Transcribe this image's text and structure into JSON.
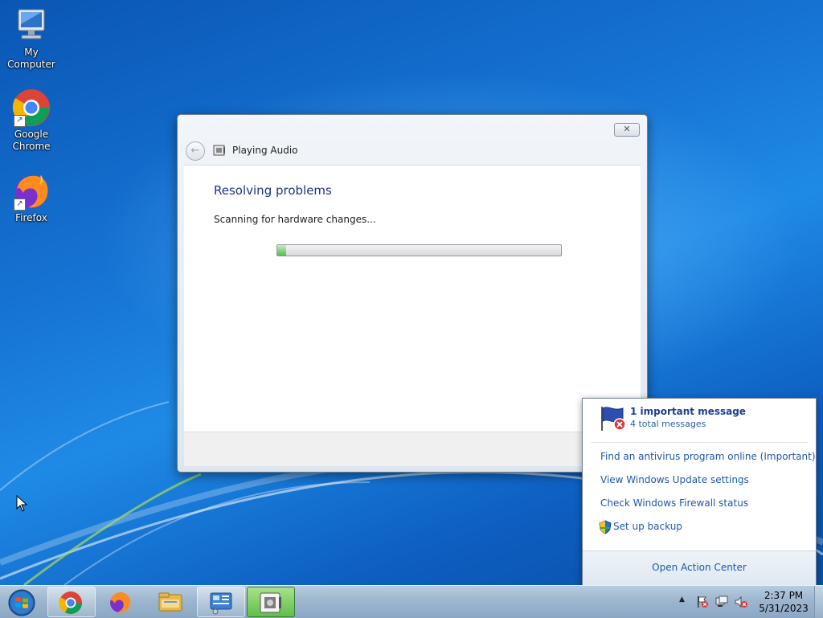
{
  "desktop": {
    "icons": [
      {
        "label": "My Computer",
        "icon": "computer-icon"
      },
      {
        "label": "Google Chrome",
        "icon": "chrome-icon"
      },
      {
        "label": "Firefox",
        "icon": "firefox-icon"
      }
    ],
    "shortcut_glyph": "↗"
  },
  "dialog": {
    "title": "Playing Audio",
    "heading": "Resolving problems",
    "status": "Scanning for hardware changes...",
    "progress_percent": 3,
    "close_glyph": "✕",
    "back_glyph": "←"
  },
  "action_center": {
    "important": "1 important message",
    "total": "4 total messages",
    "links": [
      "Find an antivirus program online (Important)",
      "View Windows Update settings",
      "Check Windows Firewall status",
      "Set up backup"
    ],
    "open_label": "Open Action Center"
  },
  "taskbar": {
    "items": [
      "start-orb",
      "chrome-icon",
      "firefox-icon",
      "file-explorer-icon",
      "control-panel-icon",
      "troubleshooter-icon"
    ],
    "tray_expand_glyph": "▲",
    "clock_time": "2:37 PM",
    "clock_date": "5/31/2023"
  },
  "colors": {
    "link": "#1f57a7",
    "heading": "#1e3287",
    "progress": "#4fbf4f",
    "desktop": "#1673d3"
  }
}
